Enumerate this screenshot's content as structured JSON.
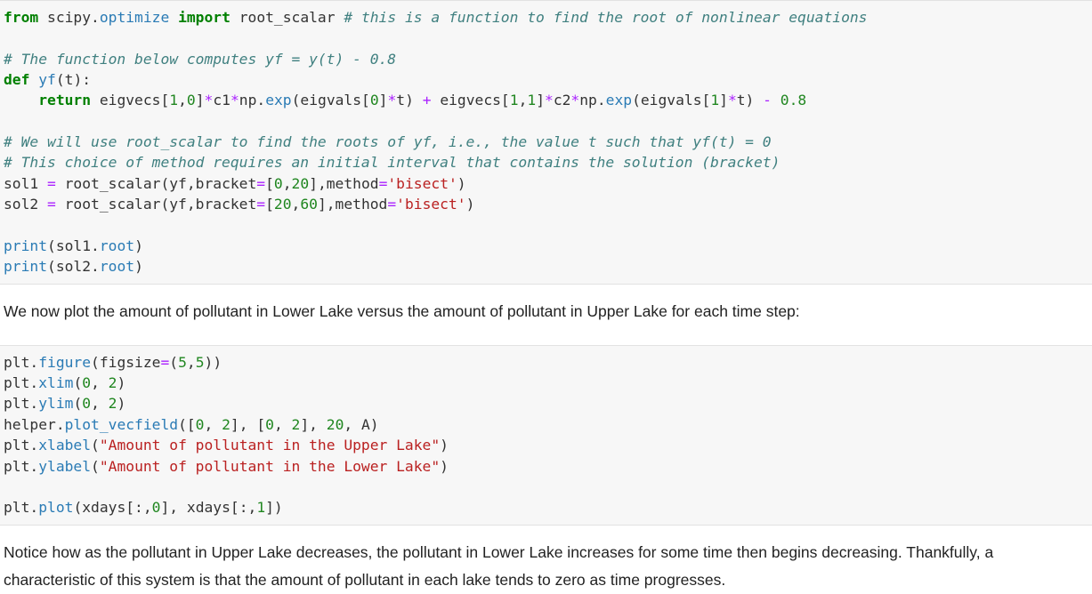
{
  "cell1": {
    "l1": {
      "a": "from",
      "b": " scipy.",
      "c": "optimize",
      "d": " ",
      "e": "import",
      "f": " root_scalar ",
      "g": "# this is a function to find the root of nonlinear equations"
    },
    "l3": {
      "a": "# The function below computes yf = y(t) - 0.8"
    },
    "l4": {
      "a": "def",
      "b": " ",
      "c": "yf",
      "d": "(t):"
    },
    "l5": {
      "i": "    ",
      "a": "return",
      "b": " eigvecs[",
      "c": "1",
      "d": ",",
      "e": "0",
      "f": "]",
      "g": "*",
      "h": "c1",
      "j": "*",
      "k": "np.",
      "l": "exp",
      "m": "(eigvals[",
      "n": "0",
      "o": "]",
      "p": "*",
      "q": "t) ",
      "r": "+",
      "s": " eigvecs[",
      "t": "1",
      "u": ",",
      "v": "1",
      "w": "]",
      "x": "*",
      "y": "c2",
      "z": "*",
      "aa": "np.",
      "ab": "exp",
      "ac": "(eigvals[",
      "ad": "1",
      "ae": "]",
      "af": "*",
      "ag": "t) ",
      "ah": "-",
      "ai": " ",
      "aj": "0.8"
    },
    "l7": {
      "a": "# We will use root_scalar to find the roots of yf, i.e., the value t such that yf(t) = 0"
    },
    "l8": {
      "a": "# This choice of method requires an initial interval that contains the solution (bracket)"
    },
    "l9": {
      "a": "sol1 ",
      "b": "=",
      "c": " root_scalar(yf,bracket",
      "d": "=",
      "e": "[",
      "f": "0",
      "g": ",",
      "h": "20",
      "i": "],method",
      "j": "=",
      "k": "'bisect'",
      "l": ")"
    },
    "l10": {
      "a": "sol2 ",
      "b": "=",
      "c": " root_scalar(yf,bracket",
      "d": "=",
      "e": "[",
      "f": "20",
      "g": ",",
      "h": "60",
      "i": "],method",
      "j": "=",
      "k": "'bisect'",
      "l": ")"
    },
    "l12": {
      "a": "print",
      "b": "(sol1.",
      "c": "root",
      "d": ")"
    },
    "l13": {
      "a": "print",
      "b": "(sol2.",
      "c": "root",
      "d": ")"
    }
  },
  "markdown1": "We now plot the amount of pollutant in Lower Lake versus the amount of pollutant in Upper Lake for each time step:",
  "cell2": {
    "l1": {
      "a": "plt.",
      "b": "figure",
      "c": "(figsize",
      "d": "=",
      "e": "(",
      "f": "5",
      "g": ",",
      "h": "5",
      "i": "))"
    },
    "l2": {
      "a": "plt.",
      "b": "xlim",
      "c": "(",
      "d": "0",
      "e": ", ",
      "f": "2",
      "g": ")"
    },
    "l3": {
      "a": "plt.",
      "b": "ylim",
      "c": "(",
      "d": "0",
      "e": ", ",
      "f": "2",
      "g": ")"
    },
    "l4": {
      "a": "helper.",
      "b": "plot_vecfield",
      "c": "([",
      "d": "0",
      "e": ", ",
      "f": "2",
      "g": "], [",
      "h": "0",
      "i": ", ",
      "j": "2",
      "k": "], ",
      "l": "20",
      "m": ", A)"
    },
    "l5": {
      "a": "plt.",
      "b": "xlabel",
      "c": "(",
      "d": "\"Amount of pollutant in the Upper Lake\"",
      "e": ")"
    },
    "l6": {
      "a": "plt.",
      "b": "ylabel",
      "c": "(",
      "d": "\"Amount of pollutant in the Lower Lake\"",
      "e": ")"
    },
    "l8": {
      "a": "plt.",
      "b": "plot",
      "c": "(xdays[:,",
      "d": "0",
      "e": "], xdays[:,",
      "f": "1",
      "g": "])"
    }
  },
  "markdown2": "Notice how as the pollutant in Upper Lake decreases, the pollutant in Lower Lake increases for some time then begins decreasing. Thankfully, a characteristic of this system is that the amount of pollutant in each lake tends to zero as time progresses.",
  "colors": {
    "keyword": "#008000",
    "function": "#2a7bb5",
    "comment": "#408080",
    "number": "#218721",
    "operator": "#aa22ff",
    "string": "#ba2121",
    "cell_bg": "#f7f7f7"
  }
}
